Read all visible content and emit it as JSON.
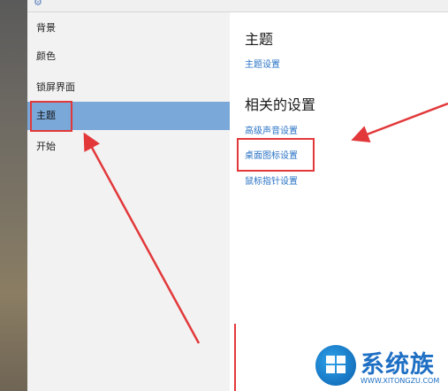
{
  "sidebar": {
    "items": [
      {
        "label": "背景"
      },
      {
        "label": "颜色"
      },
      {
        "label": "锁屏界面"
      },
      {
        "label": "主题",
        "selected": true
      },
      {
        "label": "开始"
      }
    ]
  },
  "main": {
    "theme_heading": "主题",
    "theme_settings_link": "主题设置",
    "related_heading": "相关的设置",
    "related_links": [
      "高级声音设置",
      "桌面图标设置",
      "鼠标指针设置"
    ]
  },
  "watermark": {
    "brand": "系统族",
    "url": "WWW.XITONGZU.COM"
  },
  "colors": {
    "accent_selected": "#7aa8d8",
    "link": "#2a73c5",
    "annotation": "#e2383a"
  }
}
